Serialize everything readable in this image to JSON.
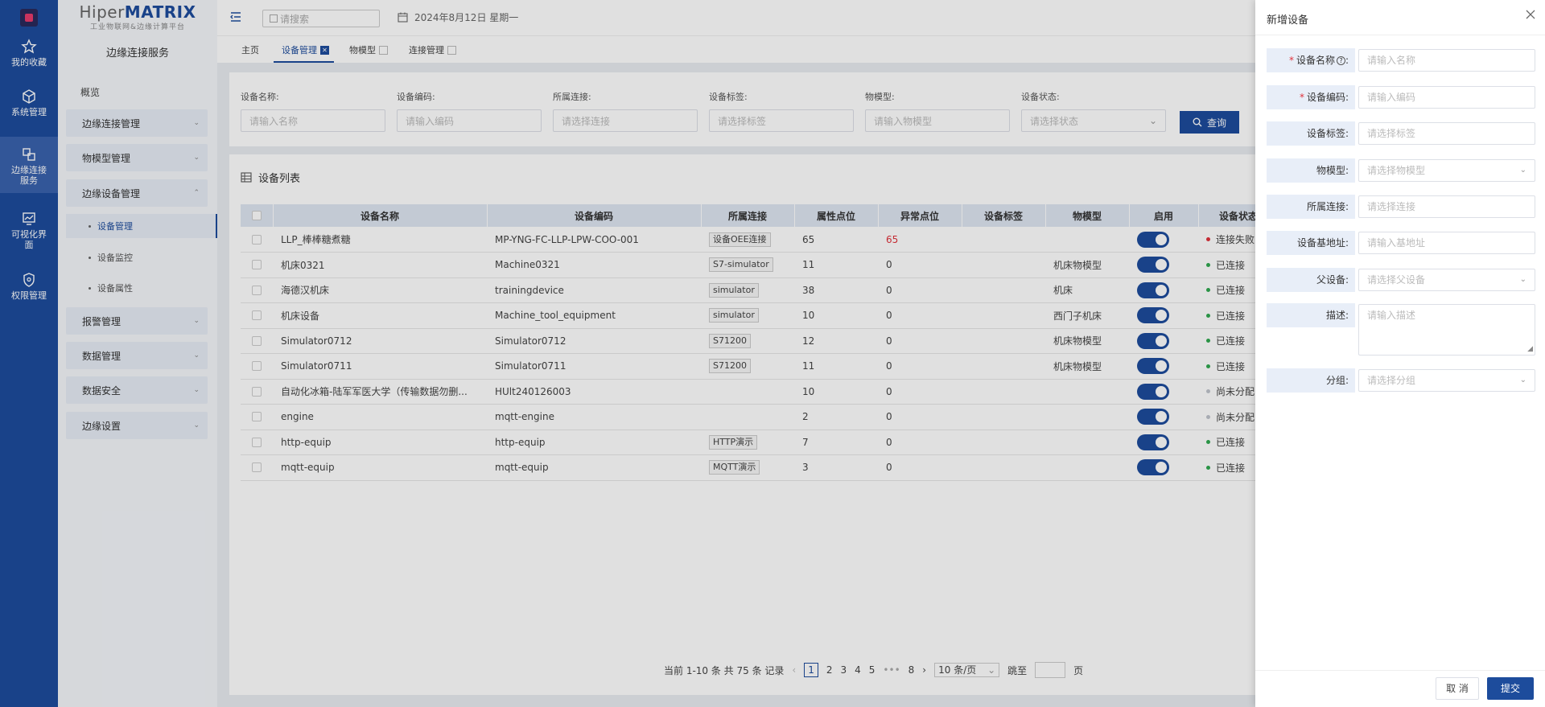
{
  "rail": {
    "items": [
      {
        "label": "我的收藏",
        "icon": "star-icon"
      },
      {
        "label": "系统管理",
        "icon": "cube-icon"
      },
      {
        "label": "边缘连接服务",
        "icon": "connect-icon"
      },
      {
        "label": "可视化界面",
        "icon": "chart-screen-icon"
      },
      {
        "label": "权限管理",
        "icon": "shield-icon"
      }
    ]
  },
  "brand": {
    "title_prefix": "Hiper",
    "title_strong": "MATRIX",
    "subtitle": "工业物联网&边缘计算平台"
  },
  "nav": {
    "title": "边缘连接服务",
    "overview": "概览",
    "groups": {
      "edge_conn": "边缘连接管理",
      "model": "物模型管理",
      "device": "边缘设备管理",
      "alarm": "报警管理",
      "data": "数据管理",
      "security": "数据安全",
      "settings": "边缘设置"
    },
    "subs": {
      "dev_mgmt": "设备管理",
      "dev_monitor": "设备监控",
      "dev_attr": "设备属性"
    }
  },
  "topbar": {
    "search_placeholder": "请搜索",
    "date": "2024年8月12日 星期一"
  },
  "tabs": [
    {
      "label": "主页"
    },
    {
      "label": "设备管理"
    },
    {
      "label": "物模型"
    },
    {
      "label": "连接管理"
    }
  ],
  "filters": [
    {
      "label": "设备名称:",
      "placeholder": "请输入名称"
    },
    {
      "label": "设备编码:",
      "placeholder": "请输入编码"
    },
    {
      "label": "所属连接:",
      "placeholder": "请选择连接"
    },
    {
      "label": "设备标签:",
      "placeholder": "请选择标签"
    },
    {
      "label": "物模型:",
      "placeholder": "请输入物模型"
    },
    {
      "label": "设备状态:",
      "placeholder": "请选择状态"
    }
  ],
  "query_button": "查询",
  "list_title": "设备列表",
  "table": {
    "headers": [
      "设备名称",
      "设备编码",
      "所属连接",
      "属性点位",
      "异常点位",
      "设备标签",
      "物模型",
      "启用",
      "设备状态"
    ],
    "rows": [
      [
        "LLP_棒棒糖煮糖",
        "MP-YNG-FC-LLP-LPW-COO-001",
        "设备OEE连接",
        "65",
        "65",
        "",
        "",
        "",
        "连接失败"
      ],
      [
        "机床0321",
        "Machine0321",
        "S7-simulator",
        "11",
        "0",
        "",
        "机床物模型",
        "",
        "已连接"
      ],
      [
        "海德汉机床",
        "trainingdevice",
        "simulator",
        "38",
        "0",
        "",
        "机床",
        "",
        "已连接"
      ],
      [
        "机床设备",
        "Machine_tool_equipment",
        "simulator",
        "10",
        "0",
        "",
        "西门子机床",
        "",
        "已连接"
      ],
      [
        "Simulator0712",
        "Simulator0712",
        "S71200",
        "12",
        "0",
        "",
        "机床物模型",
        "",
        "已连接"
      ],
      [
        "Simulator0711",
        "Simulator0711",
        "S71200",
        "11",
        "0",
        "",
        "机床物模型",
        "",
        "已连接"
      ],
      [
        "自动化冰箱-陆军军医大学（传输数据勿删...",
        "HUlt240126003",
        "",
        "10",
        "0",
        "",
        "",
        "",
        "尚未分配"
      ],
      [
        "engine",
        "mqtt-engine",
        "",
        "2",
        "0",
        "",
        "",
        "",
        "尚未分配"
      ],
      [
        "http-equip",
        "http-equip",
        "HTTP演示",
        "7",
        "0",
        "",
        "",
        "",
        "已连接"
      ],
      [
        "mqtt-equip",
        "mqtt-equip",
        "MQTT演示",
        "3",
        "0",
        "",
        "",
        "",
        "已连接"
      ]
    ],
    "status_colors": {
      "连接失败": "#e0323b",
      "已连接": "#2fa84f",
      "尚未分配": "#c0c4cc"
    }
  },
  "pager": {
    "summary": "当前 1-10 条 共 75 条 记录",
    "pages": [
      "1",
      "2",
      "3",
      "4",
      "5",
      "•••",
      "8"
    ],
    "page_size": "10 条/页",
    "jump_label": "跳至",
    "page_unit": "页"
  },
  "drawer": {
    "title": "新增设备",
    "fields": [
      {
        "label": "设备名称",
        "required": true,
        "help": true,
        "placeholder": "请输入名称",
        "dropdown": false
      },
      {
        "label": "设备编码",
        "required": true,
        "help": false,
        "placeholder": "请输入编码",
        "dropdown": false
      },
      {
        "label": "设备标签",
        "required": false,
        "help": false,
        "placeholder": "请选择标签",
        "dropdown": false
      },
      {
        "label": "物模型",
        "required": false,
        "help": false,
        "placeholder": "请选择物模型",
        "dropdown": true
      },
      {
        "label": "所属连接",
        "required": false,
        "help": false,
        "placeholder": "请选择连接",
        "dropdown": false
      },
      {
        "label": "设备基地址",
        "required": false,
        "help": false,
        "placeholder": "请输入基地址",
        "dropdown": false
      },
      {
        "label": "父设备",
        "required": false,
        "help": false,
        "placeholder": "请选择父设备",
        "dropdown": true
      },
      {
        "label": "描述",
        "required": false,
        "help": false,
        "placeholder": "请输入描述",
        "dropdown": false
      },
      {
        "label": "分组",
        "required": false,
        "help": false,
        "placeholder": "请选择分组",
        "dropdown": true
      }
    ],
    "cancel": "取 消",
    "submit": "提交"
  },
  "colors": {
    "brand": "#1d4c9c",
    "error": "#e0323b",
    "ok": "#2fa84f"
  }
}
